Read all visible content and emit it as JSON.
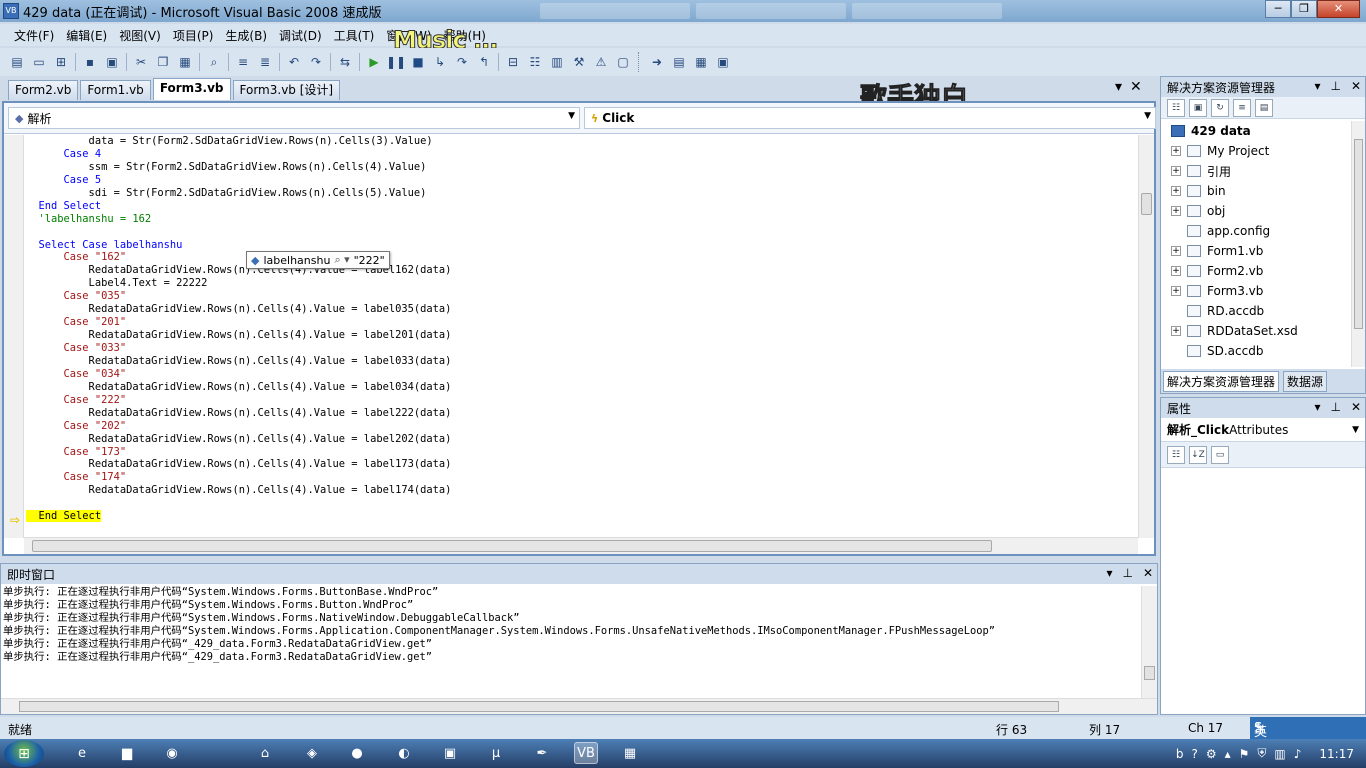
{
  "window": {
    "title": "429 data (正在调试) - Microsoft Visual Basic 2008 速成版",
    "min_label": "─",
    "max_label": "❐",
    "close_label": "✕"
  },
  "menu": {
    "items": [
      "文件(F)",
      "编辑(E)",
      "视图(V)",
      "项目(P)",
      "生成(B)",
      "调试(D)",
      "工具(T)",
      "窗口(W)",
      "帮助(H)"
    ],
    "overlay_text": "Music ..."
  },
  "overlay": {
    "singer_text": "歌手独白"
  },
  "doc_tabs": [
    "Form2.vb",
    "Form1.vb",
    "Form3.vb",
    "Form3.vb [设计]"
  ],
  "doc_tab_active_index": 2,
  "nav": {
    "left_combo": "解析",
    "right_combo": "Click"
  },
  "code_lines": [
    {
      "t": "          data = Str(Form2.SdDataGridView.Rows(n).Cells(3).Value)",
      "c": ""
    },
    {
      "t": "      Case 4",
      "c": "kw"
    },
    {
      "t": "          ssm = Str(Form2.SdDataGridView.Rows(n).Cells(4).Value)",
      "c": ""
    },
    {
      "t": "      Case 5",
      "c": "kw"
    },
    {
      "t": "          sdi = Str(Form2.SdDataGridView.Rows(n).Cells(5).Value)",
      "c": ""
    },
    {
      "t": "  End Select",
      "c": "kw"
    },
    {
      "t": "  'labelhanshu = 162",
      "c": "cm"
    },
    {
      "t": "",
      "c": ""
    },
    {
      "t": "  Select Case labelhanshu",
      "c": "kw"
    },
    {
      "t": "      Case \"162\"",
      "c": "str"
    },
    {
      "t": "          RedataDataGridView.Rows(n).Cells(4).Value = label162(data)",
      "c": ""
    },
    {
      "t": "          Label4.Text = 22222",
      "c": ""
    },
    {
      "t": "      Case \"035\"",
      "c": "str"
    },
    {
      "t": "          RedataDataGridView.Rows(n).Cells(4).Value = label035(data)",
      "c": ""
    },
    {
      "t": "      Case \"201\"",
      "c": "str"
    },
    {
      "t": "          RedataDataGridView.Rows(n).Cells(4).Value = label201(data)",
      "c": ""
    },
    {
      "t": "      Case \"033\"",
      "c": "str"
    },
    {
      "t": "          RedataDataGridView.Rows(n).Cells(4).Value = label033(data)",
      "c": ""
    },
    {
      "t": "      Case \"034\"",
      "c": "str"
    },
    {
      "t": "          RedataDataGridView.Rows(n).Cells(4).Value = label034(data)",
      "c": ""
    },
    {
      "t": "      Case \"222\"",
      "c": "str"
    },
    {
      "t": "          RedataDataGridView.Rows(n).Cells(4).Value = label222(data)",
      "c": ""
    },
    {
      "t": "      Case \"202\"",
      "c": "str"
    },
    {
      "t": "          RedataDataGridView.Rows(n).Cells(4).Value = label202(data)",
      "c": ""
    },
    {
      "t": "      Case \"173\"",
      "c": "str"
    },
    {
      "t": "          RedataDataGridView.Rows(n).Cells(4).Value = label173(data)",
      "c": ""
    },
    {
      "t": "      Case \"174\"",
      "c": "str"
    },
    {
      "t": "          RedataDataGridView.Rows(n).Cells(4).Value = label174(data)",
      "c": ""
    },
    {
      "t": "",
      "c": ""
    },
    {
      "t": "  End Select",
      "c": "hl"
    }
  ],
  "datatip": {
    "name": "labelhanshu",
    "value": "\"222\""
  },
  "solution_explorer": {
    "title": "解决方案资源管理器",
    "root": "429 data",
    "items": [
      {
        "label": "My Project",
        "expandable": true
      },
      {
        "label": "引用",
        "expandable": true
      },
      {
        "label": "bin",
        "expandable": true
      },
      {
        "label": "obj",
        "expandable": true
      },
      {
        "label": "app.config",
        "expandable": false
      },
      {
        "label": "Form1.vb",
        "expandable": true
      },
      {
        "label": "Form2.vb",
        "expandable": true
      },
      {
        "label": "Form3.vb",
        "expandable": true
      },
      {
        "label": "RD.accdb",
        "expandable": false
      },
      {
        "label": "RDDataSet.xsd",
        "expandable": true
      },
      {
        "label": "SD.accdb",
        "expandable": false
      }
    ],
    "bottom_tabs": [
      "解决方案资源管理器",
      "数据源"
    ]
  },
  "properties": {
    "title": "属性",
    "object_bold": "解析_Click",
    "object_rest": " Attributes"
  },
  "immediate": {
    "title": "即时窗口",
    "lines": [
      "单步执行: 正在逐过程执行非用户代码“System.Windows.Forms.ButtonBase.WndProc”",
      "单步执行: 正在逐过程执行非用户代码“System.Windows.Forms.Button.WndProc”",
      "单步执行: 正在逐过程执行非用户代码“System.Windows.Forms.NativeWindow.DebuggableCallback”",
      "单步执行: 正在逐过程执行非用户代码“System.Windows.Forms.Application.ComponentManager.System.Windows.Forms.UnsafeNativeMethods.IMsoComponentManager.FPushMessageLoop”",
      "单步执行: 正在逐过程执行非用户代码“_429_data.Form3.RedataDataGridView.get”",
      "单步执行: 正在逐过程执行非用户代码“_429_data.Form3.RedataDataGridView.get”"
    ]
  },
  "status": {
    "ready": "就绪",
    "row": "行 63",
    "col": "列 17",
    "ch": "Ch 17",
    "ime_lang": "英"
  },
  "taskbar": {
    "clock": "11:17"
  }
}
